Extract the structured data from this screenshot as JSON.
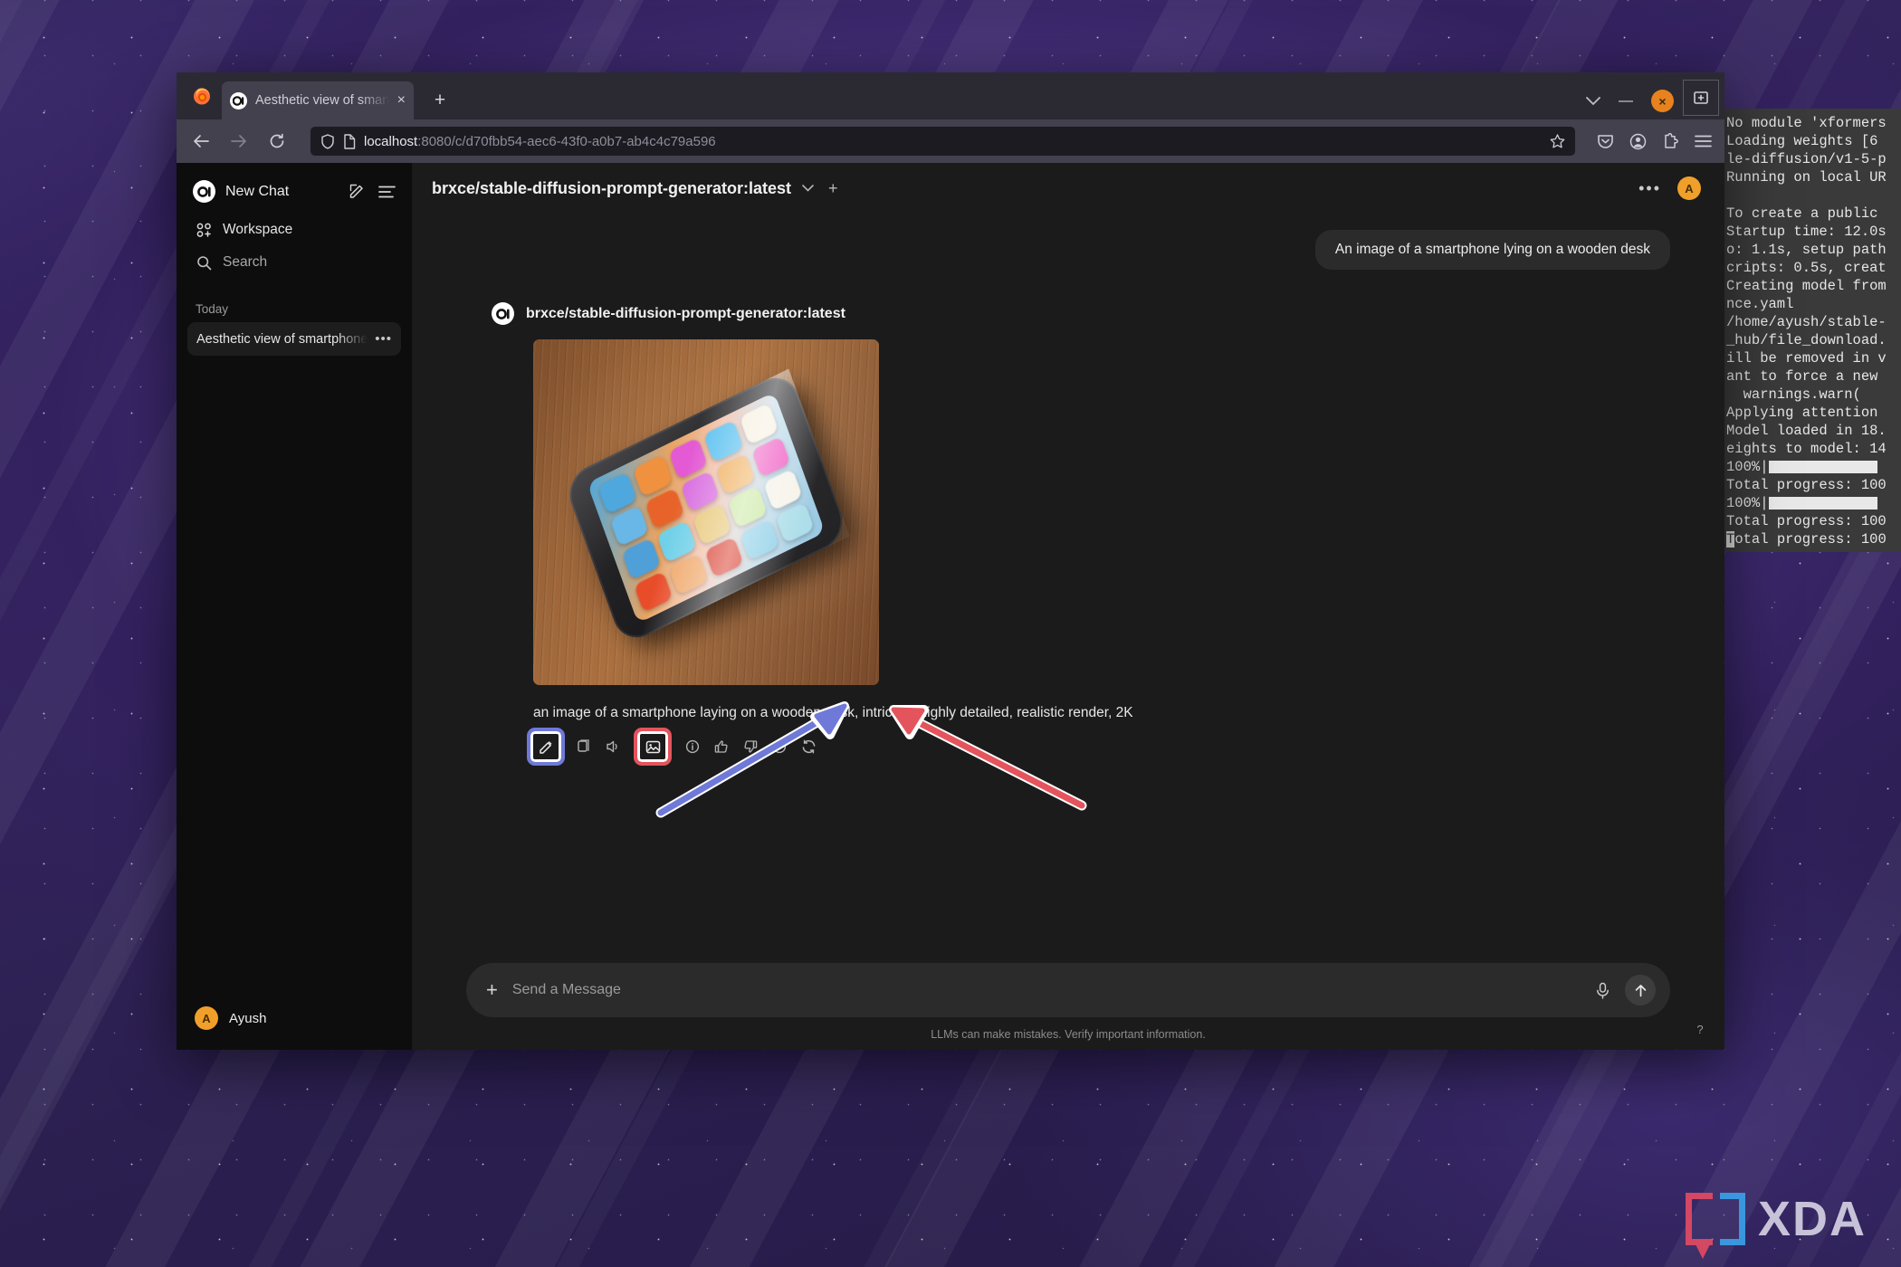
{
  "desktop": {
    "watermark_text": "XDA"
  },
  "terminal": {
    "lines": [
      "No module 'xformers",
      "Loading weights [6",
      "le-diffusion/v1-5-p",
      "Running on local UR",
      "",
      "To create a public",
      "Startup time: 12.0s",
      "o: 1.1s, setup path",
      "cripts: 0.5s, creat",
      "Creating model from",
      "nce.yaml",
      "/home/ayush/stable-",
      "_hub/file_download.",
      "ill be removed in v",
      "ant to force a new",
      "  warnings.warn(",
      "Applying attention",
      "Model loaded in 18.",
      "eights to model: 14",
      "100%|",
      "Total progress: 100",
      "100%|",
      "Total progress: 100",
      "Total progress: 100"
    ]
  },
  "browser": {
    "tab": {
      "title": "Aesthetic view of smartpho",
      "close_label": "×",
      "favicon_name": "open-webui-favicon"
    },
    "new_tab_label": "+",
    "window_controls": {
      "list_tabs": "⌄",
      "minimize": "—",
      "close": "×"
    },
    "nav": {
      "back": "←",
      "forward": "→",
      "reload": "↻"
    },
    "url": {
      "host": "localhost",
      "path": ":8080/c/d70fbb54-aec6-43f0-a0b7-ab4c4c79a596",
      "full": "localhost:8080/c/d70fbb54-aec6-43f0-a0b7-ab4c4c79a596"
    },
    "toolbar_icons": [
      "pocket-icon",
      "account-icon",
      "extensions-icon",
      "menu-icon"
    ]
  },
  "sidebar": {
    "new_chat_label": "New Chat",
    "items": [
      {
        "label": "Workspace",
        "icon": "workspace-icon"
      },
      {
        "label": "Search",
        "icon": "search-icon"
      }
    ],
    "group_label": "Today",
    "chats": [
      {
        "title": "Aesthetic view of smartphone o",
        "menu": "•••"
      }
    ],
    "user": {
      "name": "Ayush",
      "initial": "A",
      "avatar_color": "#f0a02a"
    }
  },
  "chat": {
    "model_name": "brxce/stable-diffusion-prompt-generator:latest",
    "chevron": "⌄",
    "plus": "+",
    "header_menu": "•••",
    "header_avatar_initial": "A",
    "user_message": "An image of a smartphone lying on a wooden desk",
    "assistant_name": "brxce/stable-diffusion-prompt-generator:latest",
    "assistant_text": "an image of a smartphone laying on a wooden desk, intricate, highly detailed, realistic render, 2K",
    "generated_image_alt": "smartphone lying on a wooden desk",
    "actions": [
      {
        "name": "edit-icon",
        "highlight": "blue",
        "highlight_color": "#6f79d8"
      },
      {
        "name": "copy-icon",
        "highlight": "none"
      },
      {
        "name": "speaker-icon",
        "highlight": "none"
      },
      {
        "name": "image-icon",
        "highlight": "red",
        "highlight_color": "#e4545c"
      },
      {
        "name": "info-icon",
        "highlight": "none"
      },
      {
        "name": "thumbs-up-icon",
        "highlight": "none"
      },
      {
        "name": "thumbs-down-icon",
        "highlight": "none"
      },
      {
        "name": "play-circle-icon",
        "highlight": "none"
      },
      {
        "name": "regenerate-icon",
        "highlight": "none"
      }
    ]
  },
  "composer": {
    "placeholder": "Send a Message",
    "plus": "+",
    "mic": "mic-icon",
    "send": "send-icon"
  },
  "footer": {
    "disclaimer": "LLMs can make mistakes. Verify important information.",
    "help": "?"
  },
  "annotations": [
    {
      "name": "blue-arrow",
      "color": "#6f79d8",
      "points_to": "edit-icon"
    },
    {
      "name": "red-arrow",
      "color": "#e4545c",
      "points_to": "image-icon"
    }
  ]
}
